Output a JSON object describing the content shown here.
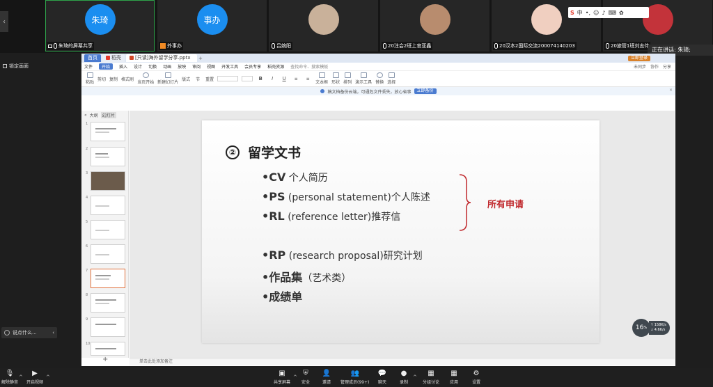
{
  "gallery": {
    "participants": [
      {
        "name": "朱琦的屏幕共享",
        "initials": "朱琦",
        "color": "#1b8ef0",
        "avatar_type": "initials"
      },
      {
        "name": "外事办",
        "initials": "事办",
        "color": "#1b8ef0",
        "avatar_type": "initials"
      },
      {
        "name": "吕婉阳",
        "initials": "",
        "color": "#c9b19a",
        "avatar_type": "photo"
      },
      {
        "name": "20注会2班上官亚鑫",
        "initials": "",
        "color": "#b88c6e",
        "avatar_type": "photo"
      },
      {
        "name": "20汉本2国际交流2000741402​03",
        "initials": "",
        "color": "#f0cfc0",
        "avatar_type": "photo"
      },
      {
        "name": "20旅管1班刘志伟",
        "initials": "",
        "color": "#c3333a",
        "avatar_type": "photo"
      }
    ],
    "speaking_label": "正在讲话: 朱琦;"
  },
  "sidebar": {
    "lock_view": "锁定画面"
  },
  "ime": {
    "label": "中"
  },
  "wps": {
    "tabs": {
      "home": "首页",
      "tab2": "稻壳",
      "doc": "[只读]海外留学分享.pptx",
      "login": "立即登录"
    },
    "menu": [
      "文件",
      "开始",
      "插入",
      "设计",
      "切换",
      "动画",
      "放映",
      "审阅",
      "视图",
      "开发工具",
      "会员专享",
      "稻壳资源"
    ],
    "search": "查找命令、搜索模板",
    "menu_right": [
      "未同步",
      "协作",
      "分享"
    ],
    "toolbar": [
      "粘贴",
      "剪切",
      "复制",
      "格式刷",
      "当页开始",
      "新建幻灯片",
      "版式",
      "节",
      "重置",
      "文本框",
      "形状",
      "排列",
      "演示工具",
      "替换",
      "选择"
    ],
    "notice": {
      "text": "稿文档备份云端，可通危文件丢失，放心省事",
      "button": "立即备份"
    },
    "panel_tabs": [
      "大纲",
      "幻灯片"
    ],
    "notes_placeholder": "单击此处添加备注",
    "slide": {
      "number": "②",
      "title": "留学文书",
      "items": [
        {
          "abbr": "•CV",
          "text": " 个人简历"
        },
        {
          "abbr": "•PS",
          "text": " (personal statement)个人陈述"
        },
        {
          "abbr": "•RL",
          "text": " (reference letter)推荐信"
        },
        {
          "abbr": "•RP",
          "text": " (research proposal)研究计划"
        },
        {
          "abbr": "•作品集",
          "text": "（艺术类）"
        },
        {
          "abbr": "•成绩单",
          "text": ""
        }
      ],
      "bracket_label": "所有申请",
      "bracket_color": "#c0282c"
    },
    "thumbnails": [
      "1",
      "2",
      "3",
      "4",
      "5",
      "6",
      "7",
      "8",
      "9",
      "10"
    ],
    "selected_slide": "7"
  },
  "overlay": {
    "zoom": "16",
    "zoom_unit": "%",
    "net_up": "158",
    "net_down": "4.6",
    "net_unit": "K/s",
    "comment": "说点什么..."
  },
  "bottombar": {
    "buttons": [
      {
        "label": "解除静音"
      },
      {
        "label": "开启视频"
      },
      {
        "label": "共享屏幕"
      },
      {
        "label": "安全"
      },
      {
        "label": "邀请"
      },
      {
        "label": "管理成员(99+)"
      },
      {
        "label": "聊天"
      },
      {
        "label": "录制"
      },
      {
        "label": "分组讨论"
      },
      {
        "label": "应用"
      },
      {
        "label": "设置"
      }
    ]
  }
}
